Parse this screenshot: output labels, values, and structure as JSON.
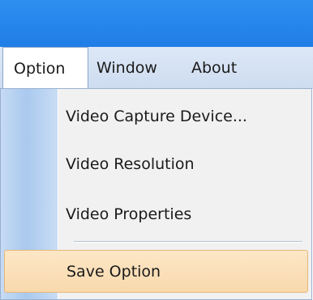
{
  "menu_bar": {
    "items": [
      {
        "label": "Option"
      },
      {
        "label": "Window"
      },
      {
        "label": "About"
      }
    ]
  },
  "option_menu": {
    "items": [
      {
        "label": "Video Capture Device..."
      },
      {
        "label": "Video Resolution"
      },
      {
        "label": "Video Properties"
      },
      {
        "label": "Save Option"
      }
    ]
  }
}
